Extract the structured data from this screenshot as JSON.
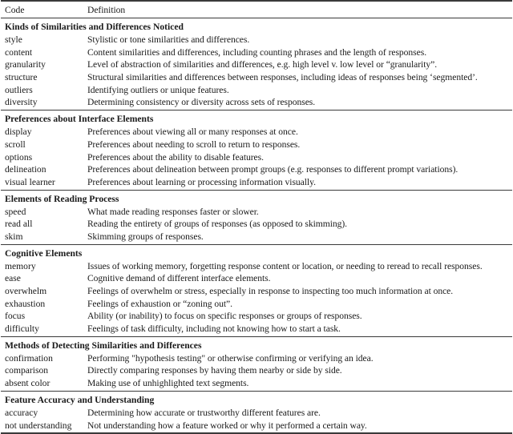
{
  "table": {
    "header": {
      "code": "Code",
      "definition": "Definition"
    },
    "sections": [
      {
        "title": "Kinds of Similarities and Differences Noticed",
        "rows": [
          {
            "code": "style",
            "definition": "Stylistic or tone similarities and differences."
          },
          {
            "code": "content",
            "definition": "Content similarities and differences, including counting phrases and the length of responses."
          },
          {
            "code": "granularity",
            "definition": "Level of abstraction of similarities and differences, e.g. high level v. low level or “granularity”."
          },
          {
            "code": "structure",
            "definition": "Structural similarities and differences between responses, including ideas of responses being ‘segmented’."
          },
          {
            "code": "outliers",
            "definition": "Identifying outliers or unique features."
          },
          {
            "code": "diversity",
            "definition": "Determining consistency or diversity across sets of responses."
          }
        ]
      },
      {
        "title": "Preferences about Interface Elements",
        "rows": [
          {
            "code": "display",
            "definition": "Preferences about viewing all or many responses at once."
          },
          {
            "code": "scroll",
            "definition": "Preferences about needing to scroll to return to responses."
          },
          {
            "code": "options",
            "definition": "Preferences about the ability to disable features."
          },
          {
            "code": "delineation",
            "definition": "Preferences about delineation between prompt groups (e.g. responses to different prompt variations)."
          },
          {
            "code": "visual learner",
            "definition": "Preferences about learning or processing information visually."
          }
        ]
      },
      {
        "title": "Elements of Reading Process",
        "rows": [
          {
            "code": "speed",
            "definition": "What made reading responses faster or slower."
          },
          {
            "code": "read all",
            "definition": "Reading the entirety of groups of responses (as opposed to skimming)."
          },
          {
            "code": "skim",
            "definition": "Skimming groups of responses."
          }
        ]
      },
      {
        "title": "Cognitive Elements",
        "rows": [
          {
            "code": "memory",
            "definition": "Issues of working memory, forgetting response content or location, or needing to reread to recall responses."
          },
          {
            "code": "ease",
            "definition": "Cognitive demand of different interface elements."
          },
          {
            "code": "overwhelm",
            "definition": "Feelings of overwhelm or stress, especially in response to inspecting too much information at once."
          },
          {
            "code": "exhaustion",
            "definition": "Feelings of exhaustion or “zoning out”."
          },
          {
            "code": "focus",
            "definition": "Ability (or inability) to focus on specific responses or groups of responses."
          },
          {
            "code": "difficulty",
            "definition": "Feelings of task difficulty, including not knowing how to start a task."
          }
        ]
      },
      {
        "title": "Methods of Detecting Similarities and Differences",
        "rows": [
          {
            "code": "confirmation",
            "definition": "Performing \"hypothesis testing\" or otherwise confirming or verifying an idea."
          },
          {
            "code": "comparison",
            "definition": "Directly comparing responses by having them nearby or side by side."
          },
          {
            "code": "absent color",
            "definition": "Making use of unhighlighted text segments."
          }
        ]
      },
      {
        "title": "Feature Accuracy and Understanding",
        "rows": [
          {
            "code": "accuracy",
            "definition": "Determining how accurate or trustworthy different features are."
          },
          {
            "code": "not understanding",
            "definition": "Not understanding how a feature worked or why it performed a certain way."
          }
        ]
      }
    ]
  }
}
